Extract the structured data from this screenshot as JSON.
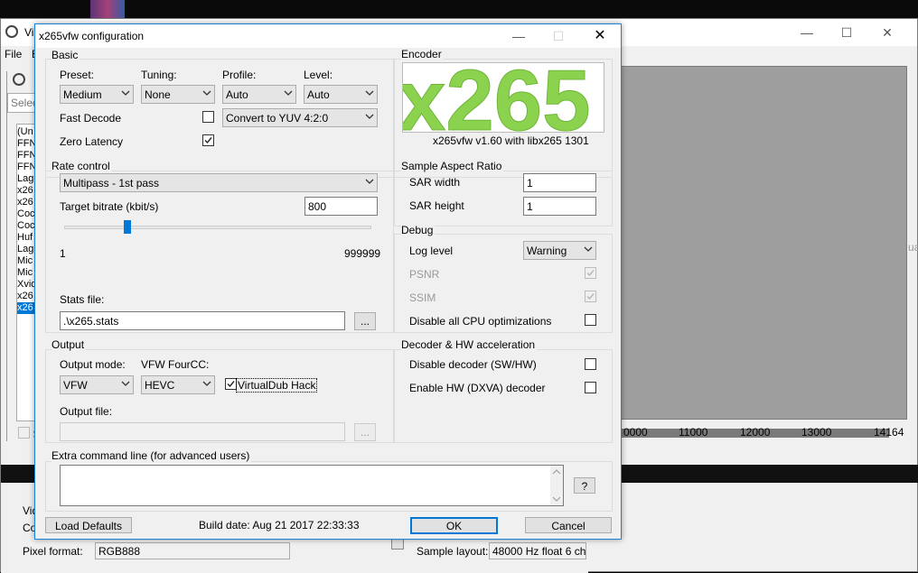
{
  "background": {
    "title_fragment": "Vi",
    "menu": [
      "File",
      "E"
    ],
    "sidebar_fragment": "S",
    "select_fragment": "Selec",
    "list_items": [
      "(Un",
      "FFN",
      "FFN",
      "FFN",
      "Lag",
      "x26",
      "x26",
      "Coc",
      "Coc",
      "Huf",
      "Lag",
      "Mic",
      "Mic",
      "Xvid",
      "x26",
      "x26"
    ],
    "checkbox_fragment": "S",
    "bottom_left_fragments": [
      "Vid",
      "Co"
    ],
    "pixel_format_label": "Pixel format:",
    "pixel_format_value": "RGB888",
    "sample_layout_label": "Sample layout:",
    "sample_layout_value": "48000 Hz float 6 ch",
    "ruler_ticks": [
      "0000",
      "11000",
      "12000",
      "13000",
      "14164"
    ],
    "right_fragment": "ua"
  },
  "dialog": {
    "title": "x265vfw configuration",
    "basic": {
      "label": "Basic",
      "preset_label": "Preset:",
      "preset_value": "Medium",
      "tuning_label": "Tuning:",
      "tuning_value": "None",
      "profile_label": "Profile:",
      "profile_value": "Auto",
      "level_label": "Level:",
      "level_value": "Auto",
      "fast_decode_label": "Fast Decode",
      "fast_decode_checked": false,
      "colorspace_value": "Convert to YUV 4:2:0",
      "zero_latency_label": "Zero Latency",
      "zero_latency_checked": true
    },
    "encoder": {
      "label": "Encoder",
      "logo_text": "x265",
      "version": "x265vfw v1.60 with libx265 1301"
    },
    "rate_control": {
      "label": "Rate control",
      "mode_value": "Multipass - 1st pass",
      "bitrate_label": "Target bitrate (kbit/s)",
      "bitrate_value": "800",
      "slider_min": "1",
      "slider_max": "999999",
      "slider_fraction": 0.2,
      "stats_label": "Stats file:",
      "stats_value": ".\\x265.stats",
      "browse_label": "..."
    },
    "sar": {
      "label": "Sample Aspect Ratio",
      "width_label": "SAR width",
      "width_value": "1",
      "height_label": "SAR height",
      "height_value": "1"
    },
    "debug": {
      "label": "Debug",
      "log_level_label": "Log level",
      "log_level_value": "Warning",
      "psnr_label": "PSNR",
      "ssim_label": "SSIM",
      "cpu_label": "Disable all CPU optimizations",
      "cpu_checked": false
    },
    "output": {
      "label": "Output",
      "mode_label": "Output mode:",
      "mode_value": "VFW",
      "fourcc_label": "VFW FourCC:",
      "fourcc_value": "HEVC",
      "hack_label": "VirtualDub Hack",
      "hack_checked": true,
      "file_label": "Output file:",
      "file_value": "",
      "browse_label": "..."
    },
    "decoder": {
      "label": "Decoder & HW acceleration",
      "disable_decoder_label": "Disable decoder (SW/HW)",
      "enable_hw_label": "Enable HW (DXVA) decoder"
    },
    "extra": {
      "label": "Extra command line (for advanced users)",
      "value": "",
      "help_label": "?"
    },
    "footer": {
      "load_defaults": "Load Defaults",
      "build_date": "Build date: Aug 21 2017 22:33:33",
      "ok": "OK",
      "cancel": "Cancel"
    }
  },
  "colors": {
    "accent": "#0078d7",
    "logo_green": "#8bd34f",
    "selection": "#0078d7"
  }
}
